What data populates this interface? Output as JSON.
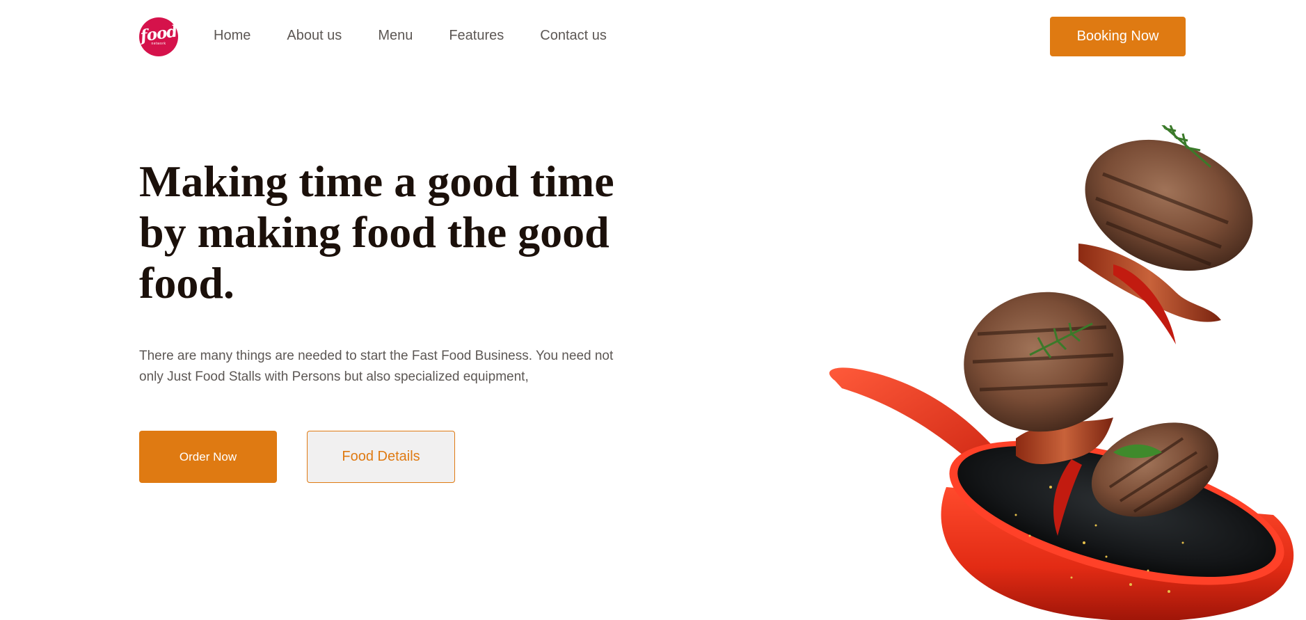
{
  "header": {
    "logo": {
      "word": "food",
      "sub": "network",
      "color": "#d5124b"
    },
    "nav": [
      {
        "label": "Home"
      },
      {
        "label": "About us"
      },
      {
        "label": "Menu"
      },
      {
        "label": "Features"
      },
      {
        "label": "Contact us"
      }
    ],
    "booking_label": "Booking Now"
  },
  "hero": {
    "title": "Making time a good time by making food the good food.",
    "description": "There are many things are needed to start the Fast Food Business. You need not only Just Food Stalls with Persons but also specialized equipment,",
    "order_label": "Order Now",
    "details_label": "Food Details",
    "image_icon": "frying-pan-with-burger-patties-illustration"
  },
  "colors": {
    "accent": "#df7a12",
    "heading": "#1b100a",
    "body_text": "#5c5754",
    "pan_red": "#e8301c"
  }
}
